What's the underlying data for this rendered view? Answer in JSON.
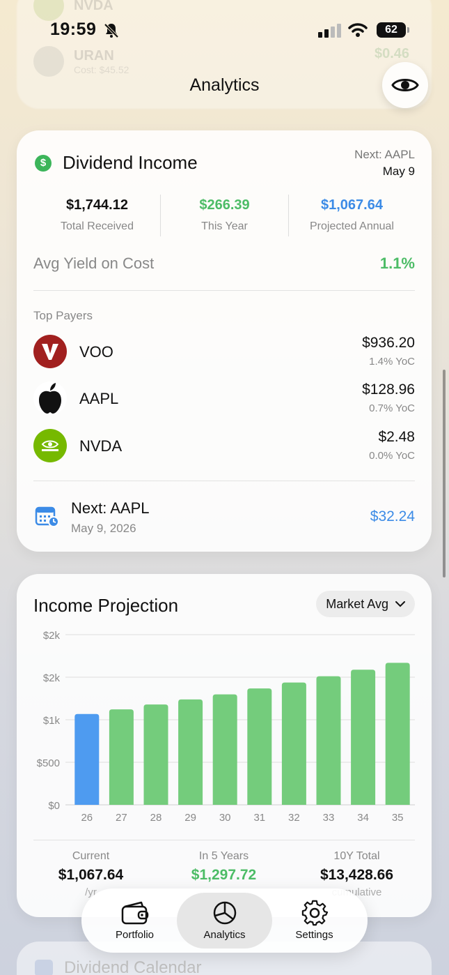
{
  "status_bar": {
    "time": "19:59",
    "battery": "62"
  },
  "header": {
    "title": "Analytics"
  },
  "background": {
    "ghost1": "NVDA",
    "ghost2": "URAN",
    "ghost2_sub": "Cost: $45.52",
    "ghost2_val": "$0.46"
  },
  "dividend": {
    "title": "Dividend Income",
    "next_label": "Next: AAPL",
    "next_date": "May 9",
    "stats": [
      {
        "value": "$1,744.12",
        "label": "Total Received",
        "color": "#111111"
      },
      {
        "value": "$266.39",
        "label": "This Year",
        "color": "#4cbc66"
      },
      {
        "value": "$1,067.64",
        "label": "Projected Annual",
        "color": "#3c8be6"
      }
    ],
    "yield_label": "Avg Yield on Cost",
    "yield_value": "1.1%",
    "top_payers_label": "Top Payers",
    "payers": [
      {
        "ticker": "VOO",
        "amount": "$936.20",
        "yoc": "1.4% YoC",
        "logo": "vanguard-logo",
        "logo_color": "#a1201f"
      },
      {
        "ticker": "AAPL",
        "amount": "$128.96",
        "yoc": "0.7% YoC",
        "logo": "apple-logo",
        "logo_color": "#111111"
      },
      {
        "ticker": "NVDA",
        "amount": "$2.48",
        "yoc": "0.0% YoC",
        "logo": "nvidia-logo",
        "logo_color": "#76b900"
      }
    ],
    "next_payment": {
      "title": "Next: AAPL",
      "date": "May 9, 2026",
      "amount": "$32.24"
    }
  },
  "projection": {
    "title": "Income Projection",
    "dropdown": "Market Avg",
    "footer": [
      {
        "label": "Current",
        "value": "$1,067.64",
        "sub": "/yr",
        "color": "#111111"
      },
      {
        "label": "In 5 Years",
        "value": "$1,297.72",
        "sub": "",
        "color": "#4cbc66"
      },
      {
        "label": "10Y Total",
        "value": "$13,428.66",
        "sub": "cumulative",
        "color": "#111111"
      }
    ]
  },
  "chart_data": {
    "type": "bar",
    "categories": [
      "26",
      "27",
      "28",
      "29",
      "30",
      "31",
      "32",
      "33",
      "34",
      "35"
    ],
    "values": [
      1067.64,
      1122,
      1179,
      1239,
      1297.72,
      1368,
      1437,
      1511,
      1588,
      1669
    ],
    "ylim": [
      0,
      2000
    ],
    "y_ticks": [
      "$0",
      "$500",
      "$1k",
      "$2k",
      "$2k"
    ],
    "y_tick_values": [
      0,
      500,
      1000,
      1500,
      2000
    ],
    "colors": {
      "current": "#4e9bf0",
      "projected": "#74cc7c"
    },
    "grid": true
  },
  "tabbar": {
    "tabs": [
      {
        "label": "Portfolio",
        "icon": "wallet-icon"
      },
      {
        "label": "Analytics",
        "icon": "pie-chart-icon"
      },
      {
        "label": "Settings",
        "icon": "gear-icon"
      }
    ],
    "active": "Analytics"
  },
  "bottom_ghost": {
    "title": "Dividend Calendar"
  }
}
